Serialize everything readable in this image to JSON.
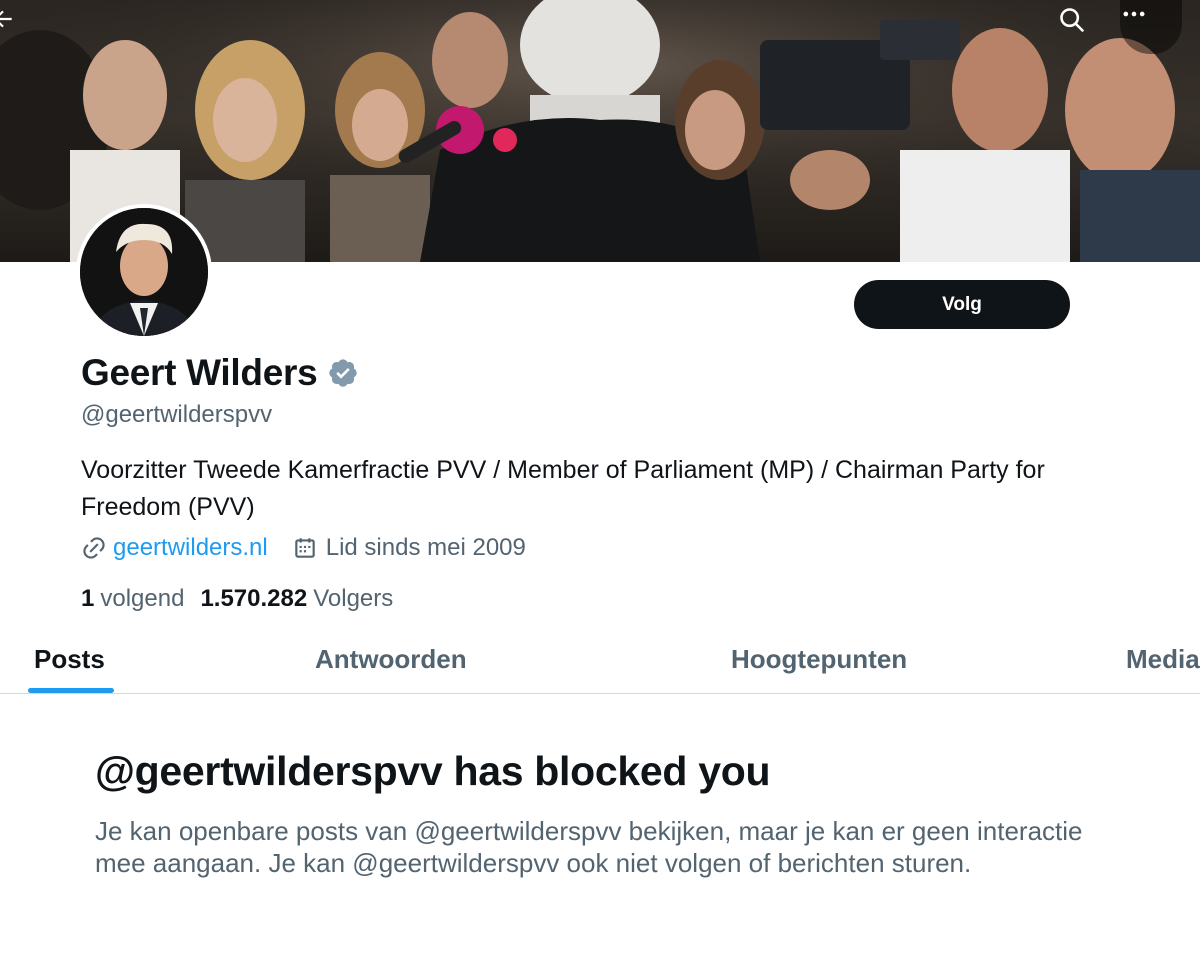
{
  "header": {
    "back_icon": "arrow-left-icon",
    "search_icon": "search-icon",
    "more_icon": "more-horizontal-icon"
  },
  "profile": {
    "name": "Geert Wilders",
    "verified_icon": "verified-badge-icon",
    "handle": "@geertwilderspvv",
    "bio": "Voorzitter Tweede Kamerfractie PVV / Member of Parliament (MP) / Chairman Party for Freedom (PVV)",
    "website": "geertwilders.nl",
    "joined": "Lid sinds mei 2009",
    "following_count": "1",
    "following_label": "volgend",
    "followers_count": "1.570.282",
    "followers_label": "Volgers",
    "follow_button": "Volg"
  },
  "tabs": [
    {
      "label": "Posts",
      "active": true
    },
    {
      "label": "Antwoorden",
      "active": false
    },
    {
      "label": "Hoogtepunten",
      "active": false
    },
    {
      "label": "Media",
      "active": false
    }
  ],
  "blocked": {
    "title": "@geertwilderspvv has blocked you",
    "description": "Je kan openbare posts van @geertwilderspvv bekijken, maar je kan er geen interactie mee aangaan. Je kan @geertwilderspvv ook niet volgen of berichten sturen."
  },
  "colors": {
    "accent": "#1d9bf0",
    "text_primary": "#0f1419",
    "text_secondary": "#536471",
    "verified": "#829aab"
  }
}
